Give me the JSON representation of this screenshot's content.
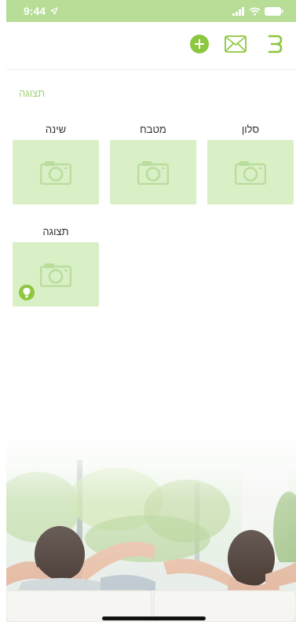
{
  "status_bar": {
    "time": "9:44"
  },
  "header": {
    "icons": [
      "add-icon",
      "mail-icon",
      "menu-icon"
    ]
  },
  "section": {
    "label": "תצוגה"
  },
  "rooms": [
    {
      "name": "סלון",
      "icon": "camera-icon"
    },
    {
      "name": "מטבח",
      "icon": "camera-icon"
    },
    {
      "name": "שינה",
      "icon": "camera-icon"
    },
    {
      "name": "תצוגה",
      "icon": "camera-icon",
      "badge": "bulb-icon"
    }
  ],
  "colors": {
    "accent": "#8dc63f",
    "status_bar": "#b7dd96",
    "card": "#d9efc6",
    "section_label": "#9fd27a"
  }
}
